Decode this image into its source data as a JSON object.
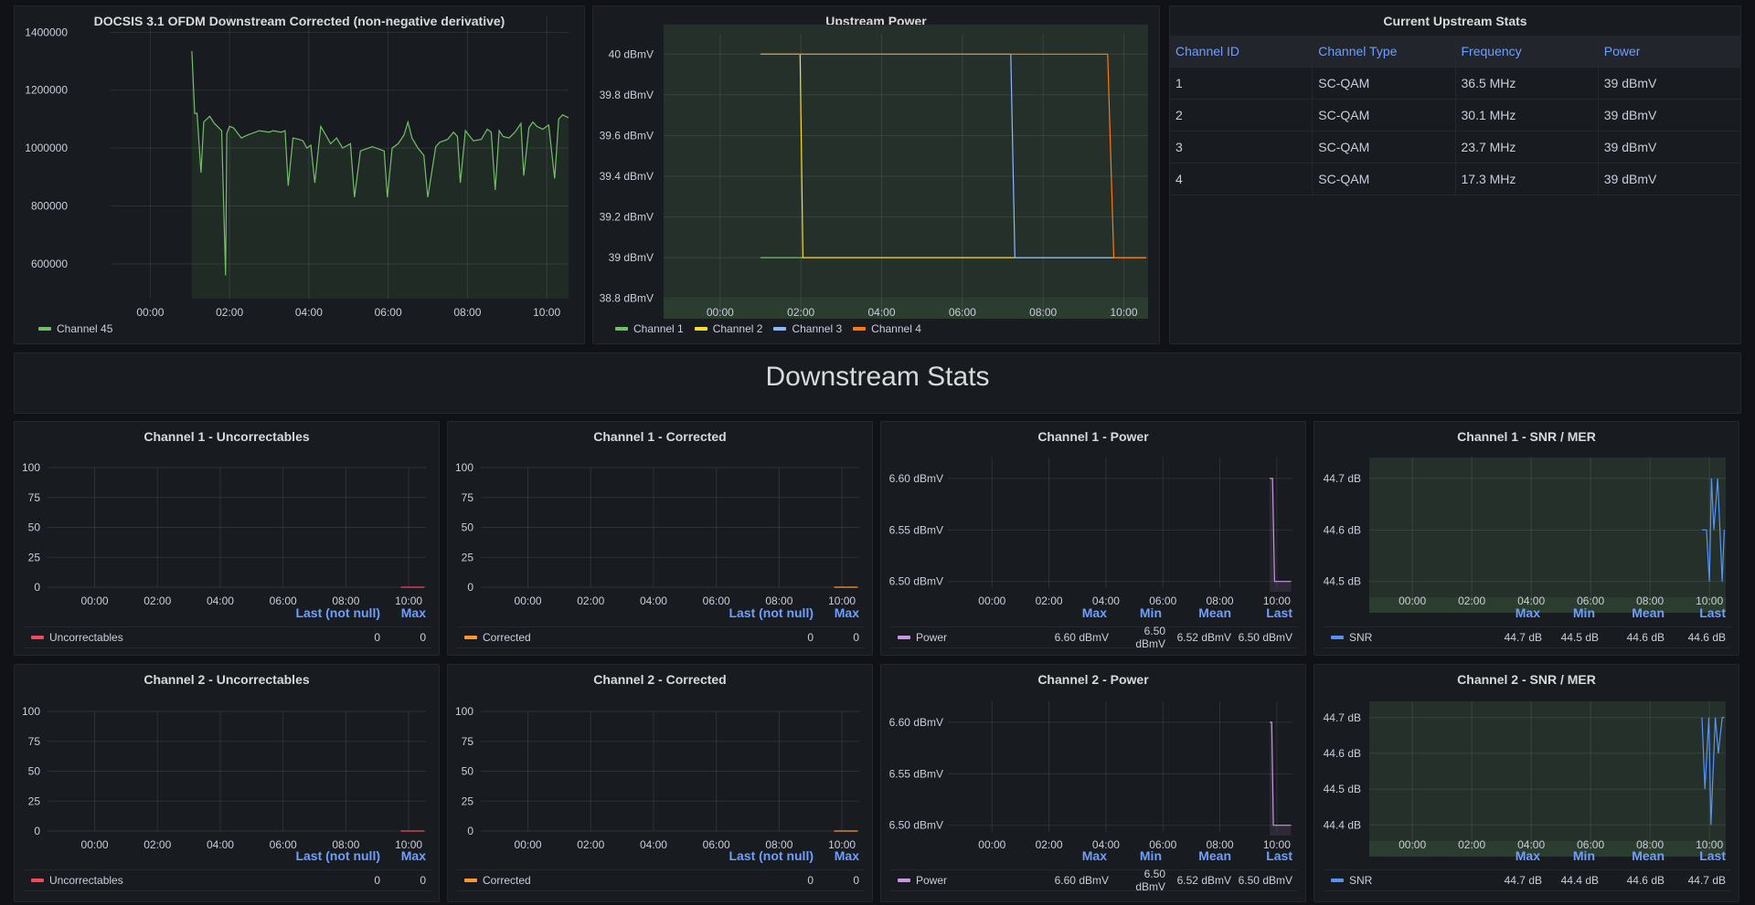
{
  "colors": {
    "green": "#73bf69",
    "yellow": "#fade2a",
    "blue": "#8ab8ff",
    "orange": "#ff780a",
    "red": "#f2495c",
    "corrected_orange": "#ff9830",
    "purple": "#ca95e5",
    "snr_blue": "#5794f2",
    "legend_header": "#6e9fff"
  },
  "top_panels": {
    "ofdm": {
      "title": "DOCSIS 3.1 OFDM Downstream Corrected (non-negative derivative)",
      "legend": [
        {
          "label": "Channel 45",
          "color": "#73bf69"
        }
      ]
    },
    "upstream_power": {
      "title": "Upstream Power",
      "legend": [
        {
          "label": "Channel 1",
          "color": "#73bf69"
        },
        {
          "label": "Channel 2",
          "color": "#fade2a"
        },
        {
          "label": "Channel 3",
          "color": "#8ab8ff"
        },
        {
          "label": "Channel 4",
          "color": "#ff780a"
        }
      ]
    },
    "upstream_stats": {
      "title": "Current Upstream Stats",
      "columns": [
        "Channel ID",
        "Channel Type",
        "Frequency",
        "Power"
      ],
      "rows": [
        [
          "1",
          "SC-QAM",
          "36.5 MHz",
          "39 dBmV"
        ],
        [
          "2",
          "SC-QAM",
          "30.1 MHz",
          "39 dBmV"
        ],
        [
          "3",
          "SC-QAM",
          "23.7 MHz",
          "39 dBmV"
        ],
        [
          "4",
          "SC-QAM",
          "17.3 MHz",
          "39 dBmV"
        ]
      ]
    }
  },
  "row_header": {
    "title": "Downstream Stats"
  },
  "small_panels": [
    {
      "title": "Channel 1 - Uncorrectables",
      "legend_headers": [
        "Last (not null)",
        "Max"
      ],
      "series": "Uncorrectables",
      "color": "#f2495c",
      "values": [
        "0",
        "0"
      ]
    },
    {
      "title": "Channel 1 - Corrected",
      "legend_headers": [
        "Last (not null)",
        "Max"
      ],
      "series": "Corrected",
      "color": "#ff9830",
      "values": [
        "0",
        "0"
      ]
    },
    {
      "title": "Channel 1 - Power",
      "legend_headers": [
        "Max",
        "Min",
        "Mean",
        "Last"
      ],
      "series": "Power",
      "color": "#ca95e5",
      "values": [
        "6.60 dBmV",
        "6.50 dBmV",
        "6.52 dBmV",
        "6.50 dBmV"
      ]
    },
    {
      "title": "Channel 1 - SNR / MER",
      "legend_headers": [
        "Max",
        "Min",
        "Mean",
        "Last"
      ],
      "series": "SNR",
      "color": "#5794f2",
      "values": [
        "44.7 dB",
        "44.5 dB",
        "44.6 dB",
        "44.6 dB"
      ]
    },
    {
      "title": "Channel 2 - Uncorrectables",
      "legend_headers": [
        "Last (not null)",
        "Max"
      ],
      "series": "Uncorrectables",
      "color": "#f2495c",
      "values": [
        "0",
        "0"
      ]
    },
    {
      "title": "Channel 2 - Corrected",
      "legend_headers": [
        "Last (not null)",
        "Max"
      ],
      "series": "Corrected",
      "color": "#ff9830",
      "values": [
        "0",
        "0"
      ]
    },
    {
      "title": "Channel 2 - Power",
      "legend_headers": [
        "Max",
        "Min",
        "Mean",
        "Last"
      ],
      "series": "Power",
      "color": "#ca95e5",
      "values": [
        "6.60 dBmV",
        "6.50 dBmV",
        "6.52 dBmV",
        "6.50 dBmV"
      ]
    },
    {
      "title": "Channel 2 - SNR / MER",
      "legend_headers": [
        "Max",
        "Min",
        "Mean",
        "Last"
      ],
      "series": "SNR",
      "color": "#5794f2",
      "values": [
        "44.7 dB",
        "44.4 dB",
        "44.6 dB",
        "44.7 dB"
      ]
    }
  ],
  "chart_data": [
    {
      "id": "ofdm",
      "type": "area",
      "title": "DOCSIS 3.1 OFDM Downstream Corrected (non-negative derivative)",
      "xlabel": "",
      "ylabel": "",
      "x_ticks": [
        "00:00",
        "02:00",
        "04:00",
        "06:00",
        "08:00",
        "10:00"
      ],
      "x_range_hours": [
        -1.0,
        10.55
      ],
      "y_ticks": [
        "600000",
        "800000",
        "1000000",
        "1200000",
        "1400000"
      ],
      "ylim": [
        480000,
        1420000
      ],
      "grid": true,
      "legend": "bottom-left",
      "series": [
        {
          "name": "Channel 45",
          "x_hours": [
            1.05,
            1.12,
            1.18,
            1.28,
            1.35,
            1.5,
            1.62,
            1.8,
            1.9,
            1.93,
            2.0,
            2.1,
            2.3,
            2.45,
            2.75,
            3.0,
            3.1,
            3.3,
            3.4,
            3.48,
            3.6,
            3.75,
            3.85,
            3.95,
            4.05,
            4.15,
            4.3,
            4.45,
            4.55,
            4.7,
            4.85,
            5.05,
            5.15,
            5.3,
            5.6,
            5.9,
            5.98,
            6.1,
            6.25,
            6.4,
            6.5,
            6.6,
            6.75,
            6.9,
            7.0,
            7.2,
            7.3,
            7.5,
            7.65,
            7.75,
            7.82,
            7.95,
            8.15,
            8.35,
            8.5,
            8.6,
            8.7,
            8.8,
            8.9,
            9.05,
            9.2,
            9.35,
            9.42,
            9.55,
            9.65,
            9.75,
            9.9,
            10.05,
            10.2,
            10.3,
            10.4,
            10.55
          ],
          "values": [
            1335000,
            1120000,
            1120000,
            915000,
            1090000,
            1110000,
            1085000,
            1060000,
            560000,
            1050000,
            1075000,
            1070000,
            1035000,
            1045000,
            1060000,
            1055000,
            1060000,
            1055000,
            1060000,
            870000,
            1035000,
            1030000,
            1025000,
            1000000,
            1010000,
            880000,
            1075000,
            1040000,
            1015000,
            1035000,
            1000000,
            1015000,
            830000,
            990000,
            1005000,
            990000,
            830000,
            1000000,
            1015000,
            1045000,
            1090000,
            1035000,
            1000000,
            975000,
            830000,
            1005000,
            1020000,
            1030000,
            1055000,
            1040000,
            880000,
            1060000,
            1025000,
            1030000,
            1065000,
            1055000,
            855000,
            1060000,
            1040000,
            1035000,
            1055000,
            1085000,
            905000,
            1070000,
            1090000,
            1075000,
            1065000,
            1080000,
            895000,
            1100000,
            1115000,
            1105000
          ]
        }
      ]
    },
    {
      "id": "upstream_power",
      "type": "line",
      "title": "Upstream Power",
      "x_ticks": [
        "00:00",
        "02:00",
        "04:00",
        "06:00",
        "08:00",
        "10:00"
      ],
      "x_range_hours": [
        -1.4,
        10.6
      ],
      "y_ticks": [
        "38.8 dBmV",
        "39 dBmV",
        "39.2 dBmV",
        "39.4 dBmV",
        "39.6 dBmV",
        "39.8 dBmV",
        "40 dBmV"
      ],
      "y_tick_values": [
        38.8,
        39,
        39.2,
        39.4,
        39.6,
        39.8,
        40
      ],
      "ylim": [
        38.7,
        40.1
      ],
      "grid": true,
      "legend": "bottom-left",
      "series": [
        {
          "name": "Channel 1",
          "x_hours": [
            1.0,
            2.05
          ],
          "values": [
            39,
            39
          ]
        },
        {
          "name": "Channel 2",
          "x_hours": [
            1.0,
            1.98,
            2.05,
            10.55
          ],
          "values": [
            40,
            40,
            39,
            39
          ]
        },
        {
          "name": "Channel 3",
          "x_hours": [
            1.0,
            7.2,
            7.3,
            9.75
          ],
          "values": [
            40,
            40,
            39,
            39
          ]
        },
        {
          "name": "Channel 4",
          "x_hours": [
            1.0,
            9.6,
            9.75,
            10.55
          ],
          "values": [
            40,
            40,
            39,
            39
          ]
        }
      ]
    },
    {
      "id": "ch1_uncorrectables",
      "type": "line",
      "title": "Channel 1 - Uncorrectables",
      "x_ticks": [
        "00:00",
        "02:00",
        "04:00",
        "06:00",
        "08:00",
        "10:00"
      ],
      "x_range_hours": [
        -1.5,
        10.55
      ],
      "y_ticks": [
        "0",
        "25",
        "50",
        "75",
        "100"
      ],
      "y_tick_values": [
        0,
        25,
        50,
        75,
        100
      ],
      "ylim": [
        0,
        100
      ],
      "series": [
        {
          "name": "Uncorrectables",
          "x_hours": [
            9.75,
            10.5
          ],
          "values": [
            0,
            0
          ]
        }
      ]
    },
    {
      "id": "ch1_corrected",
      "type": "line",
      "title": "Channel 1 - Corrected",
      "x_ticks": [
        "00:00",
        "02:00",
        "04:00",
        "06:00",
        "08:00",
        "10:00"
      ],
      "x_range_hours": [
        -1.5,
        10.55
      ],
      "y_ticks": [
        "0",
        "25",
        "50",
        "75",
        "100"
      ],
      "y_tick_values": [
        0,
        25,
        50,
        75,
        100
      ],
      "ylim": [
        0,
        100
      ],
      "series": [
        {
          "name": "Corrected",
          "x_hours": [
            9.75,
            10.5
          ],
          "values": [
            0,
            0
          ]
        }
      ]
    },
    {
      "id": "ch1_power",
      "type": "line",
      "title": "Channel 1 - Power",
      "x_ticks": [
        "00:00",
        "02:00",
        "04:00",
        "06:00",
        "08:00",
        "10:00"
      ],
      "x_range_hours": [
        -1.55,
        10.55
      ],
      "y_ticks": [
        "6.50 dBmV",
        "6.55 dBmV",
        "6.60 dBmV"
      ],
      "y_tick_values": [
        6.5,
        6.55,
        6.6
      ],
      "ylim": [
        6.49,
        6.615
      ],
      "series": [
        {
          "name": "Power",
          "x_hours": [
            9.75,
            9.85,
            9.92,
            10.5
          ],
          "values": [
            6.6,
            6.6,
            6.5,
            6.5
          ]
        }
      ]
    },
    {
      "id": "ch1_snr",
      "type": "line",
      "title": "Channel 1 - SNR / MER",
      "x_ticks": [
        "00:00",
        "02:00",
        "04:00",
        "06:00",
        "08:00",
        "10:00"
      ],
      "x_range_hours": [
        -1.45,
        10.55
      ],
      "y_ticks": [
        "44.5 dB",
        "44.6 dB",
        "44.7 dB"
      ],
      "y_tick_values": [
        44.5,
        44.6,
        44.7
      ],
      "ylim": [
        44.48,
        44.73
      ],
      "series": [
        {
          "name": "SNR",
          "x_hours": [
            9.75,
            9.9,
            10.0,
            10.07,
            10.15,
            10.28,
            10.43,
            10.5
          ],
          "values": [
            44.6,
            44.6,
            44.5,
            44.7,
            44.6,
            44.7,
            44.5,
            44.6
          ]
        }
      ]
    },
    {
      "id": "ch2_uncorrectables",
      "type": "line",
      "title": "Channel 2 - Uncorrectables",
      "x_ticks": [
        "00:00",
        "02:00",
        "04:00",
        "06:00",
        "08:00",
        "10:00"
      ],
      "x_range_hours": [
        -1.5,
        10.55
      ],
      "y_ticks": [
        "0",
        "25",
        "50",
        "75",
        "100"
      ],
      "y_tick_values": [
        0,
        25,
        50,
        75,
        100
      ],
      "ylim": [
        0,
        100
      ],
      "series": [
        {
          "name": "Uncorrectables",
          "x_hours": [
            9.75,
            10.5
          ],
          "values": [
            0,
            0
          ]
        }
      ]
    },
    {
      "id": "ch2_corrected",
      "type": "line",
      "title": "Channel 2 - Corrected",
      "x_ticks": [
        "00:00",
        "02:00",
        "04:00",
        "06:00",
        "08:00",
        "10:00"
      ],
      "x_range_hours": [
        -1.5,
        10.55
      ],
      "y_ticks": [
        "0",
        "25",
        "50",
        "75",
        "100"
      ],
      "y_tick_values": [
        0,
        25,
        50,
        75,
        100
      ],
      "ylim": [
        0,
        100
      ],
      "series": [
        {
          "name": "Corrected",
          "x_hours": [
            9.75,
            10.5
          ],
          "values": [
            0,
            0
          ]
        }
      ]
    },
    {
      "id": "ch2_power",
      "type": "line",
      "title": "Channel 2 - Power",
      "x_ticks": [
        "00:00",
        "02:00",
        "04:00",
        "06:00",
        "08:00",
        "10:00"
      ],
      "x_range_hours": [
        -1.55,
        10.55
      ],
      "y_ticks": [
        "6.50 dBmV",
        "6.55 dBmV",
        "6.60 dBmV"
      ],
      "y_tick_values": [
        6.5,
        6.55,
        6.6
      ],
      "ylim": [
        6.49,
        6.615
      ],
      "series": [
        {
          "name": "Power",
          "x_hours": [
            9.75,
            9.82,
            9.88,
            10.5
          ],
          "values": [
            6.6,
            6.6,
            6.5,
            6.5
          ]
        }
      ]
    },
    {
      "id": "ch2_snr",
      "type": "line",
      "title": "Channel 2 - SNR / MER",
      "x_ticks": [
        "00:00",
        "02:00",
        "04:00",
        "06:00",
        "08:00",
        "10:00"
      ],
      "x_range_hours": [
        -1.45,
        10.55
      ],
      "y_ticks": [
        "44.4 dB",
        "44.5 dB",
        "44.6 dB",
        "44.7 dB"
      ],
      "y_tick_values": [
        44.4,
        44.5,
        44.6,
        44.7
      ],
      "ylim": [
        44.37,
        44.73
      ],
      "series": [
        {
          "name": "SNR",
          "x_hours": [
            9.75,
            9.85,
            9.98,
            10.05,
            10.2,
            10.3,
            10.43,
            10.5
          ],
          "values": [
            44.7,
            44.5,
            44.7,
            44.4,
            44.7,
            44.6,
            44.7,
            44.7
          ]
        }
      ]
    }
  ]
}
